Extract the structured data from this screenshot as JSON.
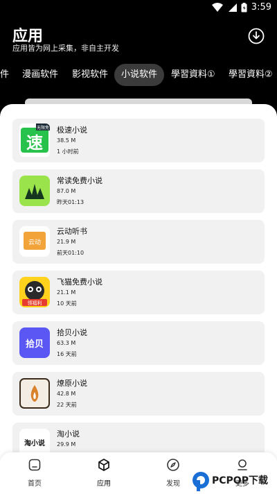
{
  "status": {
    "time": "3:59"
  },
  "header": {
    "title": "应用",
    "subtitle": "应用皆为网上采集，非自主开发"
  },
  "tabs": [
    {
      "label": "件"
    },
    {
      "label": "漫画软件"
    },
    {
      "label": "影视软件"
    },
    {
      "label": "小说软件",
      "active": true
    },
    {
      "label": "學習資料①"
    },
    {
      "label": "學習資料②"
    }
  ],
  "apps": [
    {
      "name": "极速小说",
      "size": "38.5 M",
      "time": "1 小时前",
      "icon": "su-icon",
      "icon_text": "速",
      "badge": "无限免"
    },
    {
      "name": "常读免费小说",
      "size": "87.0 M",
      "time": "昨天01:13",
      "icon": "leaf-icon"
    },
    {
      "name": "云动听书",
      "size": "21.9 M",
      "time": "前天01:10",
      "icon": "yundong-icon",
      "icon_text": "云动"
    },
    {
      "name": "飞猫免费小说",
      "size": "21.1 M",
      "time": "10 天前",
      "icon": "cat-icon",
      "badge": "领福利"
    },
    {
      "name": "拾贝小说",
      "size": "63.3 M",
      "time": "16 天前",
      "icon": "shibei-icon",
      "icon_text": "拾贝"
    },
    {
      "name": "燎原小说",
      "size": "42.8 M",
      "time": "22 天前",
      "icon": "flame-icon"
    },
    {
      "name": "淘小说",
      "size": "29.9 M",
      "time": "",
      "icon": "tao-icon",
      "icon_text": "淘小说"
    }
  ],
  "nav": [
    {
      "label": "首页",
      "icon": "home-icon"
    },
    {
      "label": "应用",
      "icon": "cube-icon"
    },
    {
      "label": "发现",
      "icon": "compass-icon"
    },
    {
      "label": "更多",
      "icon": "user-icon"
    }
  ],
  "watermark": {
    "text": "PCPOP下载"
  },
  "colors": {
    "background": "#000000",
    "sheet": "#ffffff",
    "card": "#f1f1f1",
    "active_tab": "#3b3b3b"
  }
}
